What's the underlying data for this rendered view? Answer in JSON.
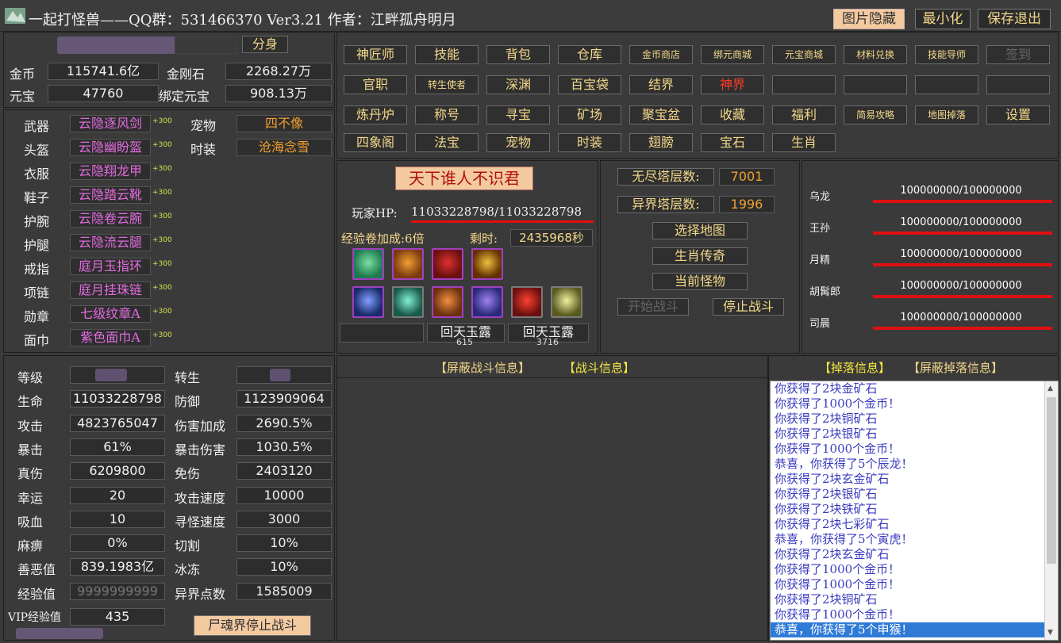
{
  "title": "一起打怪兽——QQ群：531466370 Ver3.21 作者：江畔孤舟明月",
  "top_buttons": [
    "图片隐藏",
    "最小化",
    "保存退出"
  ],
  "fenshen": "分身",
  "currency": [
    {
      "label": "金币",
      "value": "115741.6亿",
      "label2": "金刚石",
      "value2": "2268.27万"
    },
    {
      "label": "元宝",
      "value": "47760",
      "label2": "绑定元宝",
      "value2": "908.13万"
    }
  ],
  "equipment": [
    {
      "slot": "武器",
      "item": "云隐逐风剑",
      "plus": "+300"
    },
    {
      "slot": "头盔",
      "item": "云隐幽盼盔",
      "plus": "+300"
    },
    {
      "slot": "衣服",
      "item": "云隐翔龙甲",
      "plus": "+300"
    },
    {
      "slot": "鞋子",
      "item": "云隐踏云靴",
      "plus": "+300"
    },
    {
      "slot": "护腕",
      "item": "云隐卷云腕",
      "plus": "+300"
    },
    {
      "slot": "护腿",
      "item": "云隐流云腿",
      "plus": "+300"
    },
    {
      "slot": "戒指",
      "item": "庭月玉指环",
      "plus": "+300"
    },
    {
      "slot": "项链",
      "item": "庭月挂珠链",
      "plus": "+300"
    },
    {
      "slot": "勋章",
      "item": "七级纹章A",
      "plus": "+300"
    },
    {
      "slot": "面巾",
      "item": "紫色面巾A",
      "plus": "+300"
    }
  ],
  "pet": {
    "label": "宠物",
    "value": "四不像"
  },
  "fashion": {
    "label": "时装",
    "value": "沧海念雪"
  },
  "stats": [
    {
      "l1": "等级",
      "v1": "",
      "l2": "转生",
      "v2": ""
    },
    {
      "l1": "生命",
      "v1": "11033228798",
      "l2": "防御",
      "v2": "1123909064"
    },
    {
      "l1": "攻击",
      "v1": "4823765047",
      "l2": "伤害加成",
      "v2": "2690.5%"
    },
    {
      "l1": "暴击",
      "v1": "61%",
      "l2": "暴击伤害",
      "v2": "1030.5%"
    },
    {
      "l1": "真伤",
      "v1": "6209800",
      "l2": "免伤",
      "v2": "2403120"
    },
    {
      "l1": "幸运",
      "v1": "20",
      "l2": "攻击速度",
      "v2": "10000"
    },
    {
      "l1": "吸血",
      "v1": "10",
      "l2": "寻怪速度",
      "v2": "3000"
    },
    {
      "l1": "麻痹",
      "v1": "0%",
      "l2": "切割",
      "v2": "10%"
    },
    {
      "l1": "善恶值",
      "v1": "839.1983亿",
      "l2": "冰冻",
      "v2": "10%"
    },
    {
      "l1": "经验值",
      "v1": "9999999999",
      "l2": "异界点数",
      "v2": "1585009"
    }
  ],
  "vip": {
    "label": "VIP经验值",
    "value": "435"
  },
  "stop_soul": "尸魂界停止战斗",
  "menu": [
    [
      "神匠师",
      "技能",
      "背包",
      "仓库",
      "金币商店",
      "绑元商城",
      "元宝商城",
      "材料兑换",
      "技能导师",
      "签到"
    ],
    [
      "官职",
      "转生使者",
      "深渊",
      "百宝袋",
      "结界",
      "神界",
      "",
      "",
      "",
      ""
    ],
    [
      "炼丹炉",
      "称号",
      "寻宝",
      "矿场",
      "聚宝盆",
      "收藏",
      "福利",
      "简易攻略",
      "地图掉落",
      "设置"
    ],
    [
      "四象阁",
      "法宝",
      "宠物",
      "时装",
      "翅膀",
      "宝石",
      "生肖"
    ]
  ],
  "banner": "天下谁人不识君",
  "hp": {
    "label": "玩家HP:",
    "value": "11033228798/11033228798"
  },
  "exp_bonus": {
    "label": "经验卷加成:6倍",
    "remain_label": "剩时:",
    "remain": "2435968秒"
  },
  "potions": [
    {
      "name": "回天玉露",
      "count": "615"
    },
    {
      "name": "回天玉露",
      "count": "3716"
    }
  ],
  "tower": [
    {
      "label": "无尽塔层数:",
      "value": "7001"
    },
    {
      "label": "异界塔层数:",
      "value": "1996"
    }
  ],
  "actions": [
    "选择地图",
    "生肖传奇",
    "当前怪物"
  ],
  "fight": {
    "start": "开始战斗",
    "stop": "停止战斗"
  },
  "bosses": [
    {
      "name": "乌龙",
      "hp": "100000000/100000000",
      "fill": 1
    },
    {
      "name": "王孙",
      "hp": "100000000/100000000",
      "fill": 1
    },
    {
      "name": "月精",
      "hp": "100000000/100000000",
      "fill": 1
    },
    {
      "name": "胡髯郎",
      "hp": "100000000/100000000",
      "fill": 1
    },
    {
      "name": "司晨",
      "hp": "100000000/100000000",
      "fill": 1
    }
  ],
  "battle_header": [
    "【屏蔽战斗信息】",
    "【战斗信息】"
  ],
  "drop_header": [
    "【掉落信息】",
    "【屏蔽掉落信息】"
  ],
  "drop_log": [
    "你获得了2块金矿石",
    "你获得了1000个金币！",
    "你获得了2块铜矿石",
    "你获得了2块银矿石",
    "你获得了1000个金币！",
    "恭喜，你获得了5个辰龙！",
    "你获得了2块玄金矿石",
    "你获得了2块银矿石",
    "你获得了2块铁矿石",
    "你获得了2块七彩矿石",
    "恭喜，你获得了5个寅虎！",
    "你获得了2块玄金矿石",
    "你获得了1000个金币！",
    "你获得了1000个金币！",
    "你获得了2块铜矿石",
    "你获得了1000个金币！",
    "恭喜，你获得了5个申猴！"
  ]
}
